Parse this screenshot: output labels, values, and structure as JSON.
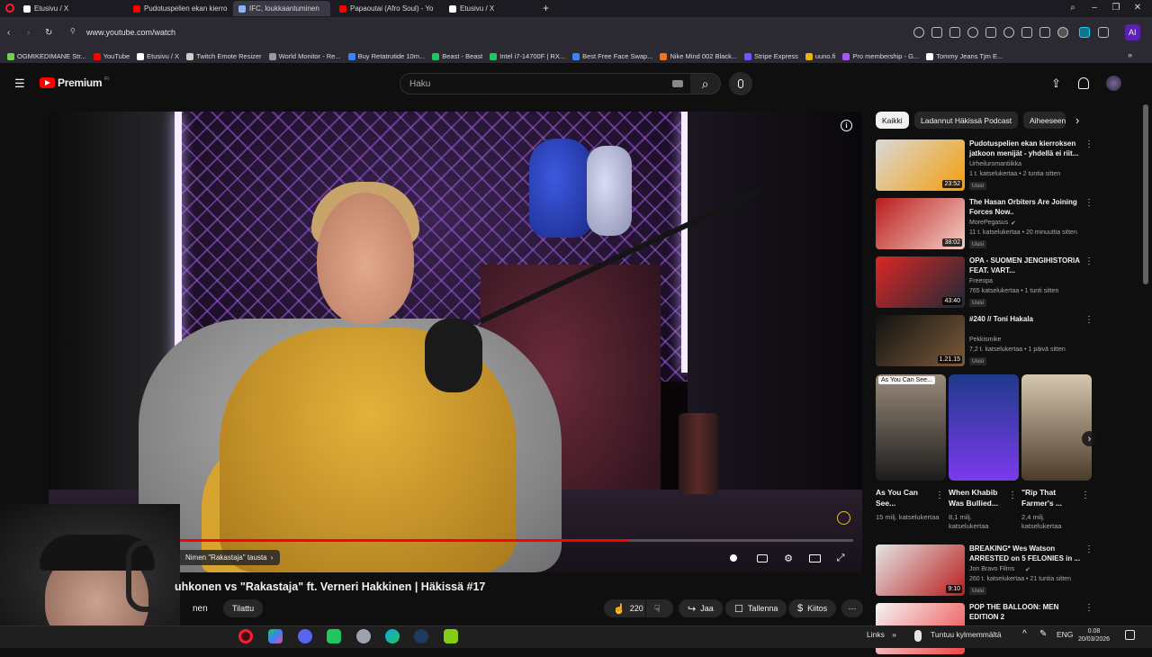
{
  "tabs": [
    {
      "label": "Etusivu / X",
      "color": "#ffffff",
      "active": false
    },
    {
      "label": "Pudotuspelien ekan kierro",
      "color": "#ff0000",
      "active": false
    },
    {
      "label": "IFC, loukkaantuminen",
      "color": "#8ab4f8",
      "active": true
    },
    {
      "label": "Papaoutai (Afro Soul) - Yo",
      "color": "#ff0000",
      "active": false
    },
    {
      "label": "Etusivu / X",
      "color": "#ffffff",
      "active": false
    }
  ],
  "new_tab": "+",
  "url": "www.youtube.com/watch",
  "ai_label": "AI",
  "bookmarks": [
    {
      "label": "OGMIKEDIMANE Str...",
      "color": "#6fd14b"
    },
    {
      "label": "YouTube",
      "color": "#ff0000"
    },
    {
      "label": "Etusivu / X",
      "color": "#ffffff"
    },
    {
      "label": "Twitch Emote Resizer",
      "color": "#cccccc"
    },
    {
      "label": "World Monitor - Re...",
      "color": "#999999"
    },
    {
      "label": "Buy Retatrutide 10m...",
      "color": "#3b82f6"
    },
    {
      "label": "Beast - Beast",
      "color": "#22c55e"
    },
    {
      "label": "Intel i7-14700F | RX...",
      "color": "#22c55e"
    },
    {
      "label": "Best Free Face Swap...",
      "color": "#3b82f6"
    },
    {
      "label": "Nike Mind 002 Black...",
      "color": "#f97316"
    },
    {
      "label": "Stripe Express",
      "color": "#635bff"
    },
    {
      "label": "uuno.fi",
      "color": "#eab308"
    },
    {
      "label": "Pro membership - G...",
      "color": "#a855f7"
    },
    {
      "label": "Tommy Jeans Tjm E...",
      "color": "#ffffff"
    }
  ],
  "youtube": {
    "logo": "Premium",
    "logo_sup": "FI",
    "search_placeholder": "Haku"
  },
  "video": {
    "title": "uhkonen vs \"Rakastaja\" ft. Verneri Hakkinen | Häkissä #17",
    "chip": "Nimen \"Rakastaja\" tausta",
    "progress": 0.72,
    "channel": "nen",
    "subscribe": "Tilattu",
    "likes": "220",
    "share": "Jaa",
    "save": "Tallenna",
    "thanks": "Kiitos"
  },
  "filter_chips": [
    "Kaikki",
    "Ladannut Häkissä Podcast",
    "Aiheeseen"
  ],
  "recommendations": [
    {
      "title": "Pudotuspelien ekan kierroksen jatkoon menijät - yhdellä ei riit...",
      "channel": "Urheiluromantiikka",
      "meta": "1 t. katselukertaa • 2 tuntia sitten",
      "badge": "Uusi",
      "duration": "23:52",
      "thumb_a": "#d9d9d9",
      "thumb_b": "#f59e0b",
      "verified": false
    },
    {
      "title": "The Hasan Orbiters Are Joining Forces Now..",
      "channel": "MorePegasus",
      "meta": "11 t. katselukertaa • 20 minuuttia sitten",
      "badge": "Uusi",
      "duration": "38:02",
      "thumb_a": "#b91c1c",
      "thumb_b": "#f5d0c5",
      "verified": true
    },
    {
      "title": "OPA - SUOMEN JENGIHISTORIA FEAT. VART...",
      "channel": "Freeopa",
      "meta": "765 katselukertaa • 1 tunti sitten",
      "badge": "Uusi",
      "duration": "43:40",
      "thumb_a": "#dc2626",
      "thumb_b": "#1f2937",
      "verified": false
    },
    {
      "title": "#240 // Toni Hakala",
      "channel": "Pekkismike",
      "meta": "7,2 t. katselukertaa • 1 päivä sitten",
      "badge": "Uusi",
      "duration": "1.21.15",
      "thumb_a": "#111111",
      "thumb_b": "#7c5a3a",
      "verified": false
    },
    {
      "title": "BREAKING* Wes Watson ARRESTED on 5 FELONIES in ...",
      "channel": "Jon Bravo Films",
      "meta": "260 t. katselukertaa • 21 tuntia sitten",
      "badge": "Uusi",
      "duration": "9:10",
      "thumb_a": "#e5e5e5",
      "thumb_b": "#b91c1c",
      "verified": true
    },
    {
      "title": "POP THE BALLOON: MEN EDITION 2",
      "channel": "",
      "meta": "",
      "badge": "",
      "duration": "",
      "thumb_a": "#f5f5f5",
      "thumb_b": "#ef4444",
      "verified": false
    }
  ],
  "shorts": [
    {
      "title": "As You Can See...",
      "views": "15 milj. katselukertaa",
      "overlay": "As You Can See...",
      "color_a": "#9a8a7a",
      "color_b": "#1c1c1c"
    },
    {
      "title": "When Khabib Was Bullied...",
      "views": "8,1 milj. katselukertaa",
      "overlay": "",
      "color_a": "#1e3a8a",
      "color_b": "#7c3aed"
    },
    {
      "title": "\"Rip That Farmer's ...",
      "views": "2,4 milj. katselukertaa",
      "overlay": "",
      "color_a": "#d6c7b0",
      "color_b": "#4b3b2b"
    }
  ],
  "taskbar": {
    "links": "Links",
    "weather": "Tuntuu kylmemmältä",
    "lang": "ENG",
    "time": "0.08",
    "date": "20/03/2026"
  },
  "icons": {
    "menu": "☰",
    "search": "⌕",
    "mic": "🎤",
    "upload": "⇪",
    "bell": "🔔",
    "like": "👍",
    "dislike": "👎",
    "share": "↪",
    "save": "☐",
    "thanks": "$",
    "more": "⋯",
    "kebab": "⋮",
    "chevron_right": "›",
    "info": "i"
  },
  "colors": {
    "youtube_red": "#ff0000",
    "bg": "#0f0f0f",
    "chip_bg": "#272727"
  }
}
